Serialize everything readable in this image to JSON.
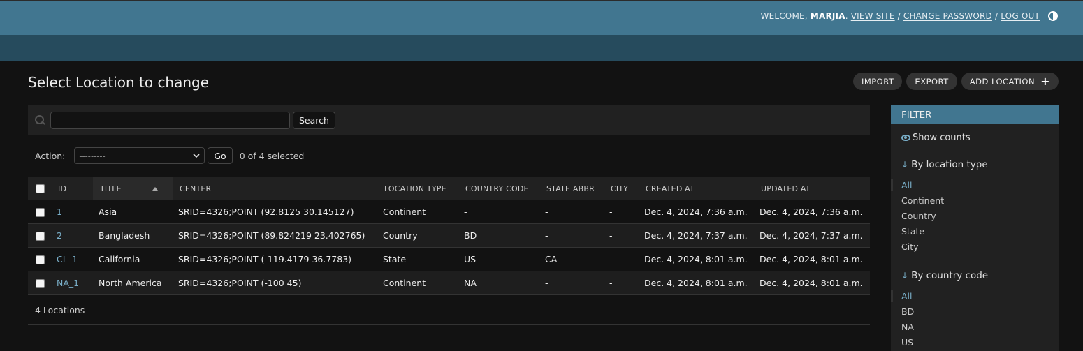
{
  "header": {
    "welcome": "WELCOME,",
    "username": "MARJIA",
    "view_site": "VIEW SITE",
    "change_password": "CHANGE PASSWORD",
    "log_out": "LOG OUT",
    "sep": "/"
  },
  "page": {
    "title": "Select Location to change"
  },
  "object_tools": {
    "import": "IMPORT",
    "export": "EXPORT",
    "add": "ADD LOCATION"
  },
  "search": {
    "value": "",
    "button": "Search"
  },
  "actions": {
    "label": "Action:",
    "selected_option": "---------",
    "go": "Go",
    "selection_count": "0 of 4 selected"
  },
  "table": {
    "headers": [
      "ID",
      "TITLE",
      "CENTER",
      "LOCATION TYPE",
      "COUNTRY CODE",
      "STATE ABBR",
      "CITY",
      "CREATED AT",
      "UPDATED AT"
    ],
    "rows": [
      {
        "id": "1",
        "title": "Asia",
        "center": "SRID=4326;POINT (92.8125 30.145127)",
        "location_type": "Continent",
        "country_code": "-",
        "state_abbr": "-",
        "city": "-",
        "created_at": "Dec. 4, 2024, 7:36 a.m.",
        "updated_at": "Dec. 4, 2024, 7:36 a.m."
      },
      {
        "id": "2",
        "title": "Bangladesh",
        "center": "SRID=4326;POINT (89.824219 23.402765)",
        "location_type": "Country",
        "country_code": "BD",
        "state_abbr": "-",
        "city": "-",
        "created_at": "Dec. 4, 2024, 7:37 a.m.",
        "updated_at": "Dec. 4, 2024, 7:37 a.m."
      },
      {
        "id": "CL_1",
        "title": "California",
        "center": "SRID=4326;POINT (-119.4179 36.7783)",
        "location_type": "State",
        "country_code": "US",
        "state_abbr": "CA",
        "city": "-",
        "created_at": "Dec. 4, 2024, 8:01 a.m.",
        "updated_at": "Dec. 4, 2024, 8:01 a.m."
      },
      {
        "id": "NA_1",
        "title": "North America",
        "center": "SRID=4326;POINT (-100 45)",
        "location_type": "Continent",
        "country_code": "NA",
        "state_abbr": "-",
        "city": "-",
        "created_at": "Dec. 4, 2024, 8:01 a.m.",
        "updated_at": "Dec. 4, 2024, 8:01 a.m."
      }
    ]
  },
  "paginator": {
    "text": "4 Locations"
  },
  "filter": {
    "title": "FILTER",
    "show_counts": "Show counts",
    "groups": [
      {
        "title": "By location type",
        "arrow": "↓",
        "items": [
          "All",
          "Continent",
          "Country",
          "State",
          "City"
        ],
        "selected": 0
      },
      {
        "title": "By country code",
        "arrow": "↓",
        "items": [
          "All",
          "BD",
          "NA",
          "US"
        ],
        "selected": 0
      }
    ]
  },
  "colors": {
    "header_bg": "#417690",
    "nav_bg": "#264b5d",
    "link": "#79aec8",
    "page_bg": "#121212"
  }
}
